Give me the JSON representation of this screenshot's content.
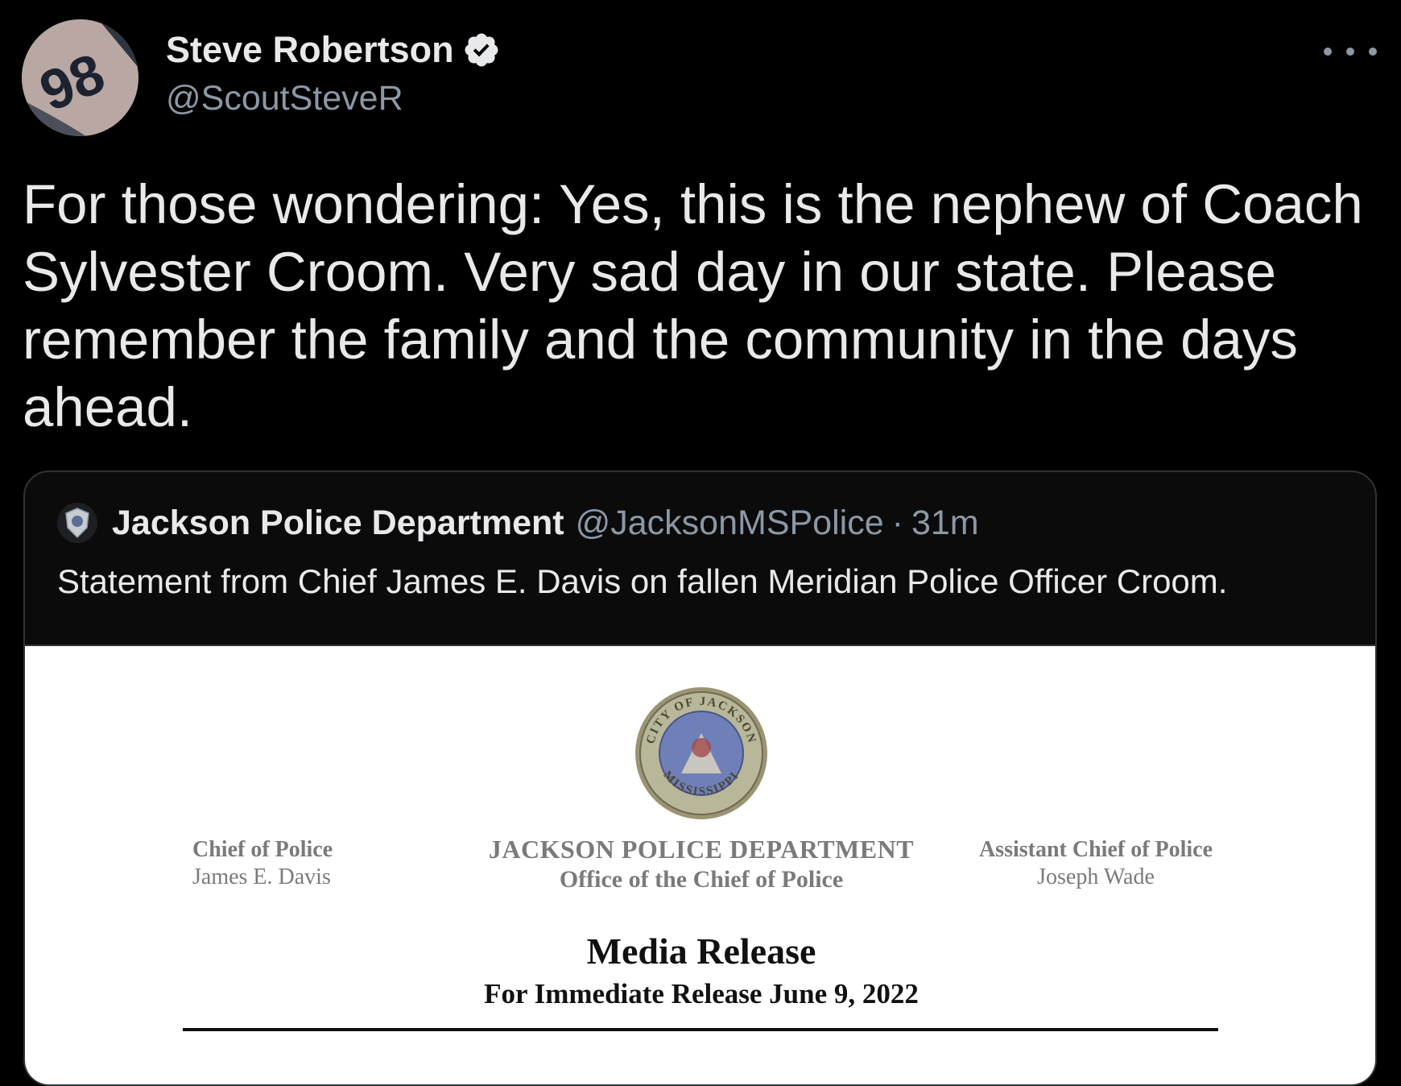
{
  "tweet": {
    "author_name": "Steve Robertson",
    "author_handle": "@ScoutSteveR",
    "avatar_number": "98",
    "text": "For those wondering: Yes, this is the nephew of Coach Sylvester Croom. Very sad day in our state. Please remember the family and the community in the days ahead.",
    "verified_icon": "verified-badge-icon",
    "more_icon": "more-options-icon"
  },
  "quote": {
    "author_name": "Jackson Police Department",
    "author_handle": "@JacksonMSPolice",
    "separator": "·",
    "time": "31m",
    "text": "Statement from Chief James E. Davis on fallen Meridian Police Officer Croom.",
    "document": {
      "seal_top_text": "CITY OF JACKSON",
      "seal_bottom_text": "MISSISSIPPI",
      "left_title": "Chief of Police",
      "left_name": "James E. Davis",
      "center_title": "JACKSON POLICE DEPARTMENT",
      "center_subtitle": "Office of the Chief of Police",
      "right_title": "Assistant Chief of Police",
      "right_name": "Joseph Wade",
      "heading": "Media Release",
      "subheading": "For Immediate Release June 9, 2022"
    }
  },
  "colors": {
    "background": "#000000",
    "primary_text": "#e7e9ea",
    "secondary_text": "#8b98a5",
    "border": "#2f3336"
  }
}
